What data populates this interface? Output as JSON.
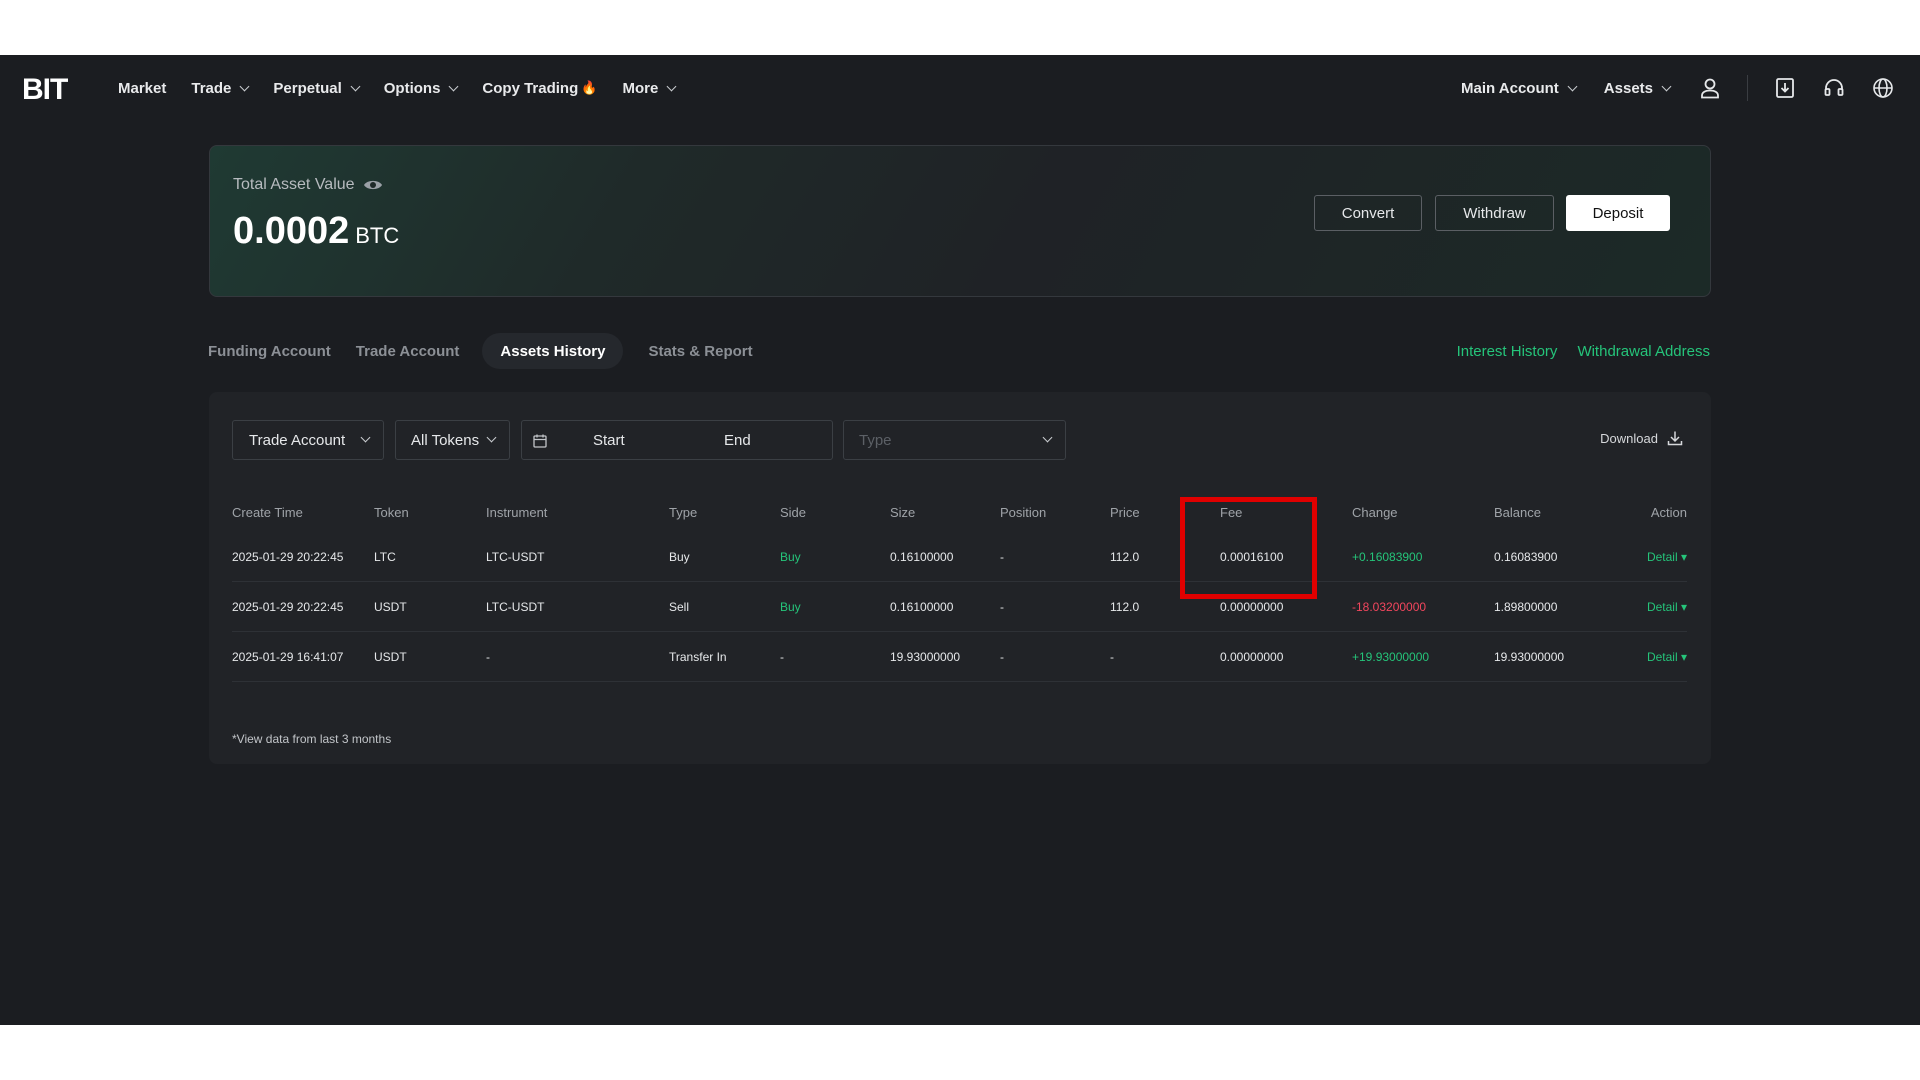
{
  "nav": {
    "logo": "BIT",
    "items": [
      "Market",
      "Trade",
      "Perpetual",
      "Options",
      "Copy Trading",
      "More"
    ],
    "right": [
      "Main Account",
      "Assets"
    ]
  },
  "asset": {
    "label": "Total Asset Value",
    "value": "0.0002",
    "unit": "BTC",
    "buttons": [
      "Convert",
      "Withdraw",
      "Deposit"
    ]
  },
  "tabs": [
    "Funding Account",
    "Trade Account",
    "Assets History",
    "Stats & Report"
  ],
  "links": [
    "Interest History",
    "Withdrawal Address"
  ],
  "filters": {
    "account": "Trade Account",
    "tokens": "All Tokens",
    "start": "Start",
    "end": "End",
    "type_placeholder": "Type",
    "download": "Download"
  },
  "table": {
    "headers": [
      "Create Time",
      "Token",
      "Instrument",
      "Type",
      "Side",
      "Size",
      "Position",
      "Price",
      "Fee",
      "Change",
      "Balance",
      "Action"
    ],
    "rows": [
      [
        "2025-01-29 20:22:45",
        "LTC",
        "LTC-USDT",
        "Buy",
        "Buy",
        "0.16100000",
        "-",
        "112.0",
        "0.00016100",
        "+0.16083900",
        "0.16083900",
        "Detail"
      ],
      [
        "2025-01-29 20:22:45",
        "USDT",
        "LTC-USDT",
        "Sell",
        "Buy",
        "0.16100000",
        "-",
        "112.0",
        "0.00000000",
        "-18.03200000",
        "1.89800000",
        "Detail"
      ],
      [
        "2025-01-29 16:41:07",
        "USDT",
        "-",
        "Transfer In",
        "-",
        "19.93000000",
        "-",
        "-",
        "0.00000000",
        "+19.93000000",
        "19.93000000",
        "Detail"
      ]
    ],
    "note": "*View data from last 3 months"
  },
  "colors": {
    "accent": "#25c47a",
    "negative": "#f2465d",
    "highlight": "#e00000"
  }
}
